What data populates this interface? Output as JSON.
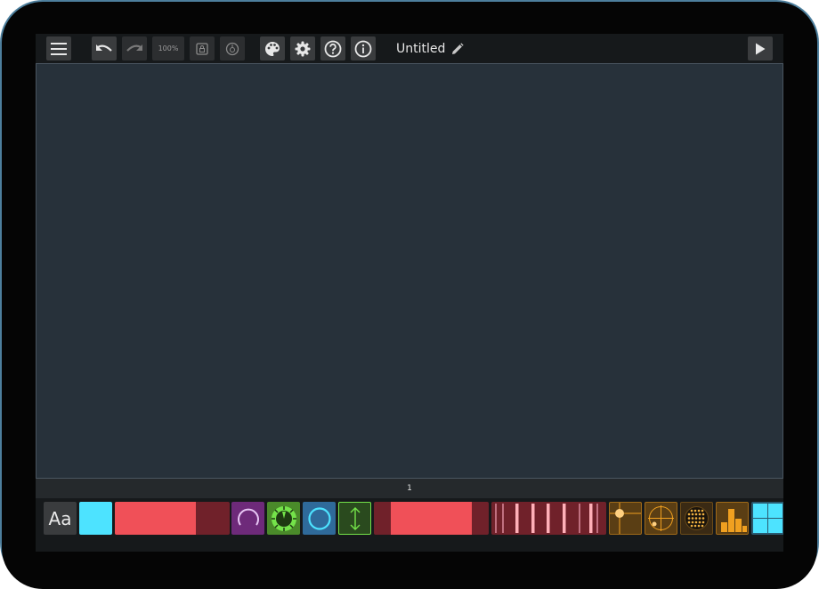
{
  "toolbar": {
    "menu_icon": "hamburger-icon",
    "undo_icon": "undo-icon",
    "redo_icon": "redo-icon",
    "zoom_label": "100%",
    "lock_icon": "lock-icon",
    "snap_icon": "snap-icon",
    "theme_icon": "palette-icon",
    "settings_icon": "gear-icon",
    "help_icon": "question-icon",
    "info_icon": "info-icon",
    "title": "Untitled",
    "rename_icon": "pencil-icon",
    "play_icon": "play-icon"
  },
  "page_bar": {
    "page_number": "1"
  },
  "palette": {
    "text_widget_label": "Aa",
    "colors": {
      "cyan": "#4de3ff",
      "red": "#f05058",
      "red_dark": "#70212a",
      "purple": "#6e2a7a",
      "green": "#74e34a",
      "blue": "#4db8f0",
      "orange": "#f0a020"
    },
    "widgets": [
      {
        "name": "text",
        "icon": "text-icon"
      },
      {
        "name": "button",
        "icon": "square-icon"
      },
      {
        "name": "fader",
        "icon": "fader-icon"
      },
      {
        "name": "knob",
        "icon": "knob-icon"
      },
      {
        "name": "encoder",
        "icon": "encoder-icon"
      },
      {
        "name": "radial",
        "icon": "radial-icon"
      },
      {
        "name": "switch",
        "icon": "updown-arrow-icon"
      },
      {
        "name": "slider",
        "icon": "slider-icon"
      },
      {
        "name": "multislider",
        "icon": "multislider-icon"
      },
      {
        "name": "xy-pad",
        "icon": "xy-icon"
      },
      {
        "name": "polar-pad",
        "icon": "polar-icon"
      },
      {
        "name": "matrix",
        "icon": "dot-grid-icon"
      },
      {
        "name": "bars",
        "icon": "bars-icon"
      },
      {
        "name": "grid",
        "icon": "grid-icon"
      }
    ]
  }
}
